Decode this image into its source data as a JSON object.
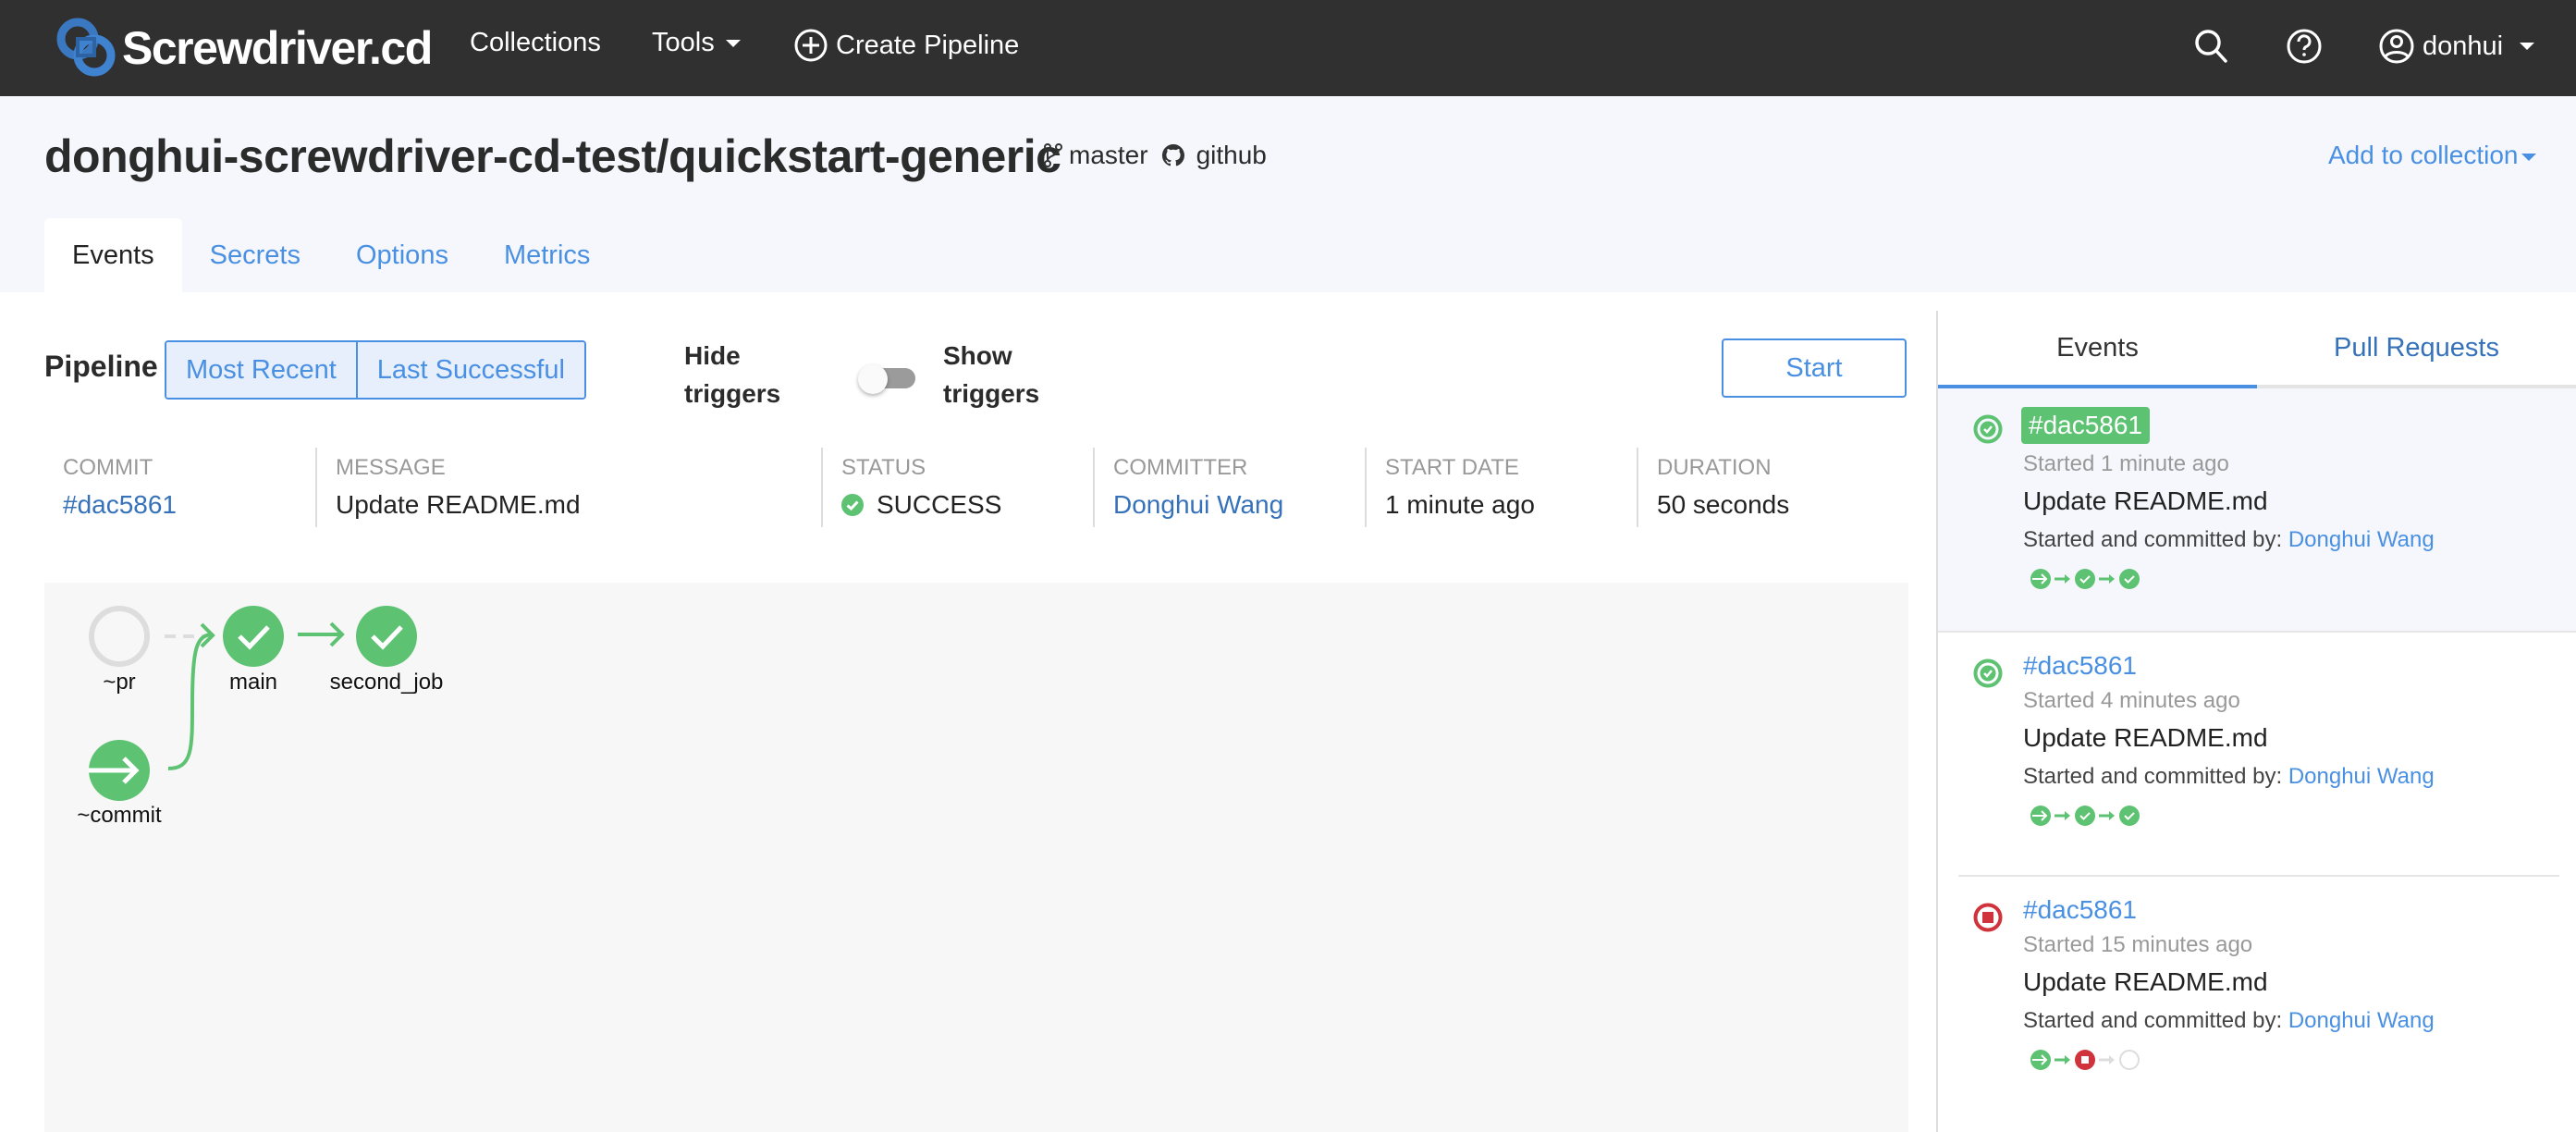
{
  "nav": {
    "brand": "Screwdriver.cd",
    "items": [
      {
        "label": "Collections"
      },
      {
        "label": "Tools",
        "has_dropdown": true
      },
      {
        "label": "Create Pipeline",
        "icon": "plus-circle-icon"
      }
    ],
    "right_icons": [
      "search-icon",
      "help-icon"
    ],
    "user": {
      "name": "donhui",
      "icon": "user-circle-icon"
    }
  },
  "header": {
    "repo": "donghui-screwdriver-cd-test/quickstart-generic",
    "branch": "master",
    "scm": "github",
    "add_to_collection": "Add to collection",
    "tabs": [
      {
        "label": "Events",
        "active": true
      },
      {
        "label": "Secrets"
      },
      {
        "label": "Options"
      },
      {
        "label": "Metrics"
      }
    ]
  },
  "pipeline": {
    "label": "Pipeline",
    "view_buttons": [
      "Most Recent",
      "Last Successful"
    ],
    "hide_triggers": [
      "Hide",
      "triggers"
    ],
    "show_triggers": [
      "Show",
      "triggers"
    ],
    "show_triggers_on": false,
    "start_label": "Start"
  },
  "event_info": {
    "columns": [
      {
        "label": "COMMIT",
        "value": "#dac5861",
        "link": true
      },
      {
        "label": "MESSAGE",
        "value": "Update README.md"
      },
      {
        "label": "STATUS",
        "value": "SUCCESS",
        "status": "success"
      },
      {
        "label": "COMMITTER",
        "value": "Donghui Wang",
        "link": true
      },
      {
        "label": "START DATE",
        "value": "1 minute ago"
      },
      {
        "label": "DURATION",
        "value": "50 seconds"
      }
    ]
  },
  "workflow_graph": {
    "nodes": [
      {
        "id": "pr",
        "label": "~pr",
        "status": "inactive"
      },
      {
        "id": "commit",
        "label": "~commit",
        "status": "trigger"
      },
      {
        "id": "main",
        "label": "main",
        "status": "success"
      },
      {
        "id": "second_job",
        "label": "second_job",
        "status": "success"
      }
    ],
    "edges": [
      {
        "from": "pr",
        "to": "main",
        "style": "dashed"
      },
      {
        "from": "commit",
        "to": "main",
        "style": "solid"
      },
      {
        "from": "main",
        "to": "second_job",
        "style": "solid"
      }
    ]
  },
  "side_panel": {
    "tabs": [
      {
        "label": "Events",
        "active": true
      },
      {
        "label": "Pull Requests"
      }
    ],
    "events": [
      {
        "sha": "#dac5861",
        "status": "success",
        "selected": true,
        "started": "Started 1 minute ago",
        "message": "Update README.md",
        "by_label": "Started and committed by: ",
        "by": "Donghui Wang",
        "mini": [
          "trigger",
          "success",
          "success"
        ]
      },
      {
        "sha": "#dac5861",
        "status": "success",
        "selected": false,
        "started": "Started 4 minutes ago",
        "message": "Update README.md",
        "by_label": "Started and committed by: ",
        "by": "Donghui Wang",
        "mini": [
          "trigger",
          "success",
          "success"
        ]
      },
      {
        "sha": "#dac5861",
        "status": "aborted",
        "selected": false,
        "started": "Started 15 minutes ago",
        "message": "Update README.md",
        "by_label": "Started and committed by: ",
        "by": "Donghui Wang",
        "mini": [
          "trigger",
          "aborted",
          "inactive"
        ]
      }
    ]
  },
  "colors": {
    "nav_bg": "#303030",
    "accent": "#4a90e2",
    "link": "#3672b9",
    "success": "#5ec273",
    "failure": "#d0333c",
    "inactive": "#dddddd"
  }
}
